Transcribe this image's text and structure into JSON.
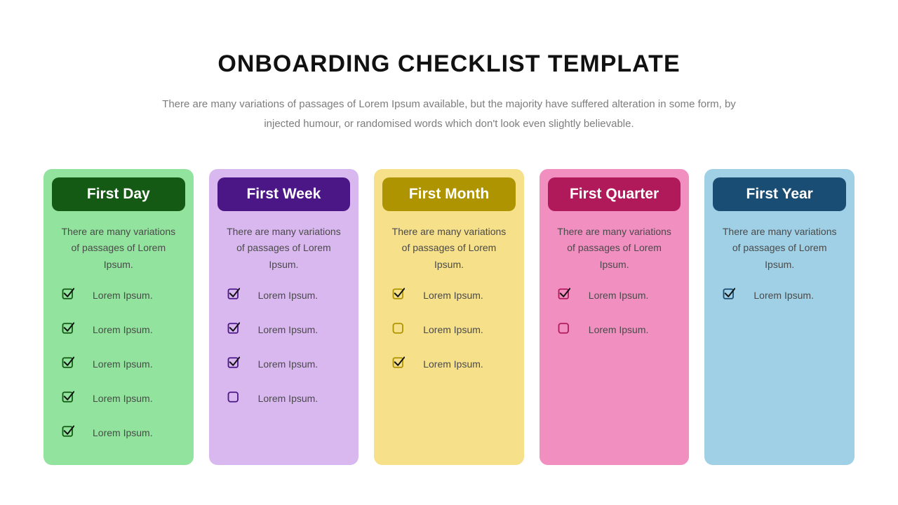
{
  "title": "ONBOARDING CHECKLIST TEMPLATE",
  "subtitle": "There are many variations of passages of Lorem Ipsum available, but the majority have suffered alteration in some form, by injected humour, or randomised words which don't look even slightly believable.",
  "cards": [
    {
      "title": "First Day",
      "desc": "There are many variations of passages of Lorem Ipsum.",
      "bg": "#92e39d",
      "header_bg": "#145a14",
      "stroke": "#145a14",
      "items": [
        {
          "label": "Lorem Ipsum.",
          "checked": true
        },
        {
          "label": "Lorem Ipsum.",
          "checked": true
        },
        {
          "label": "Lorem Ipsum.",
          "checked": true
        },
        {
          "label": "Lorem Ipsum.",
          "checked": true
        },
        {
          "label": "Lorem Ipsum.",
          "checked": true
        }
      ]
    },
    {
      "title": "First Week",
      "desc": "There are many variations of passages of Lorem Ipsum.",
      "bg": "#d9b8ef",
      "header_bg": "#4b1787",
      "stroke": "#4b1787",
      "items": [
        {
          "label": "Lorem Ipsum.",
          "checked": true
        },
        {
          "label": "Lorem Ipsum.",
          "checked": true
        },
        {
          "label": "Lorem Ipsum.",
          "checked": true
        },
        {
          "label": "Lorem Ipsum.",
          "checked": false
        }
      ]
    },
    {
      "title": "First Month",
      "desc": "There are many variations of passages of Lorem Ipsum.",
      "bg": "#f6e08a",
      "header_bg": "#ad9400",
      "stroke": "#ad9400",
      "items": [
        {
          "label": "Lorem Ipsum.",
          "checked": true
        },
        {
          "label": "Lorem Ipsum.",
          "checked": false
        },
        {
          "label": "Lorem Ipsum.",
          "checked": true
        }
      ]
    },
    {
      "title": "First Quarter",
      "desc": "There are many variations of passages of Lorem Ipsum.",
      "bg": "#f28fc1",
      "header_bg": "#b01a5b",
      "stroke": "#b01a5b",
      "items": [
        {
          "label": "Lorem Ipsum.",
          "checked": true
        },
        {
          "label": "Lorem Ipsum.",
          "checked": false
        }
      ]
    },
    {
      "title": "First Year",
      "desc": "There are many variations of passages of Lorem Ipsum.",
      "bg": "#9fd0e6",
      "header_bg": "#1a4d73",
      "stroke": "#1a4d73",
      "items": [
        {
          "label": "Lorem Ipsum.",
          "checked": true
        }
      ]
    }
  ]
}
